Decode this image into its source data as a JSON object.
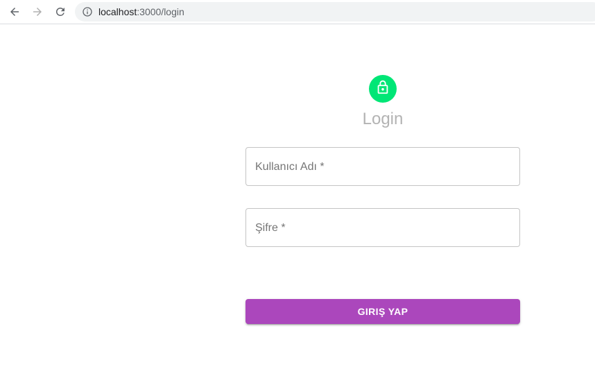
{
  "browser": {
    "url_host": "localhost",
    "url_rest": ":3000/login"
  },
  "login": {
    "title": "Login",
    "username_label": "Kullanıcı Adı *",
    "password_label": "Şifre *",
    "submit_label": "GIRIŞ YAP"
  },
  "colors": {
    "avatar": "#00e676",
    "button": "#ab47bc"
  },
  "icons": {
    "avatar": "lock-icon"
  }
}
